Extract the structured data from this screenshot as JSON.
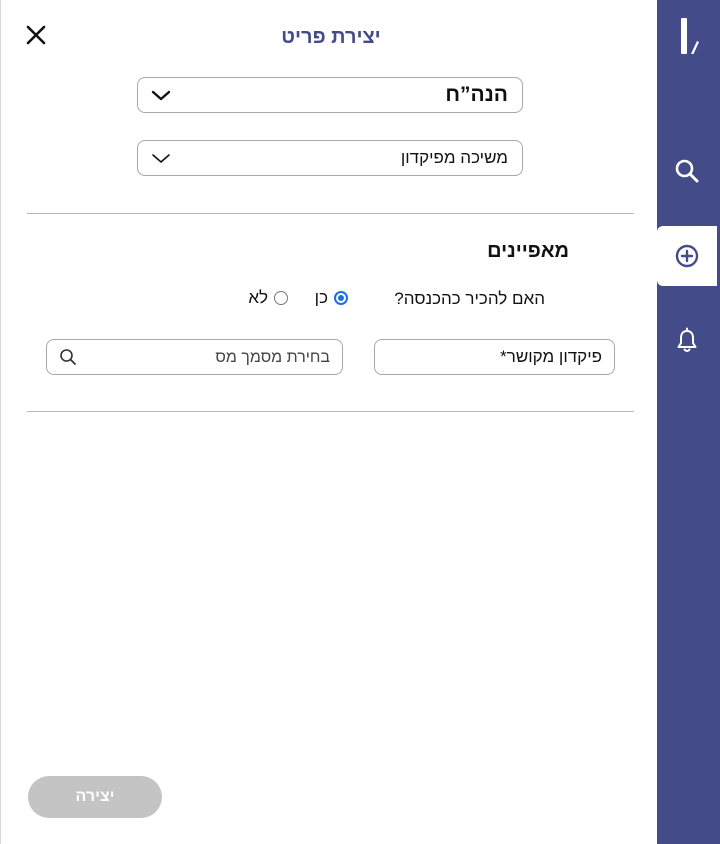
{
  "header": {
    "title": "יצירת פריט",
    "close_icon": "close-icon"
  },
  "selects": {
    "category_value": "הנה”ח",
    "type_value": "משיכה מפיקדון"
  },
  "attributes": {
    "section_title": "מאפיינים",
    "recognize_question": "האם להכיר כהכנסה?",
    "radio_yes_label": "כן",
    "radio_no_label": "לא",
    "radio_selected": "כן",
    "related_deposit_label": "פיקדון מקושר*",
    "tax_document_placeholder": "בחירת מסמך מס"
  },
  "footer": {
    "create_label": "יצירה"
  },
  "rail": {
    "icons": [
      "logo-icon",
      "search-icon",
      "add-circle-icon",
      "bell-icon"
    ]
  },
  "colors": {
    "rail_bg": "#434c88",
    "title": "#434c88",
    "radio_accent": "#1a6ee6",
    "disabled_button": "#c4c4c4"
  }
}
